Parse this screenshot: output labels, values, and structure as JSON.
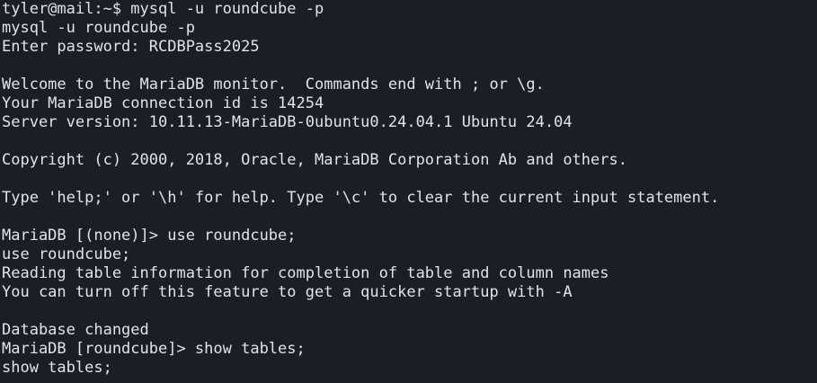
{
  "terminal": {
    "lines": [
      "tyler@mail:~$ mysql -u roundcube -p",
      "mysql -u roundcube -p",
      "Enter password: RCDBPass2025",
      "",
      "Welcome to the MariaDB monitor.  Commands end with ; or \\g.",
      "Your MariaDB connection id is 14254",
      "Server version: 10.11.13-MariaDB-0ubuntu0.24.04.1 Ubuntu 24.04",
      "",
      "Copyright (c) 2000, 2018, Oracle, MariaDB Corporation Ab and others.",
      "",
      "Type 'help;' or '\\h' for help. Type '\\c' to clear the current input statement.",
      "",
      "MariaDB [(none)]> use roundcube;",
      "use roundcube;",
      "Reading table information for completion of table and column names",
      "You can turn off this feature to get a quicker startup with -A",
      "",
      "Database changed",
      "MariaDB [roundcube]> show tables;",
      "show tables;"
    ],
    "colors": {
      "background": "#1b1e27",
      "foreground": "#dfe3ea"
    }
  }
}
